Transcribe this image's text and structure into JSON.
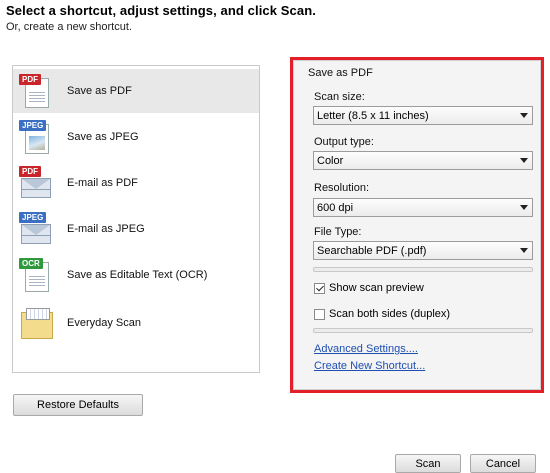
{
  "header": {
    "title": "Select a shortcut, adjust settings, and click Scan.",
    "subtitle": "Or, create a new shortcut."
  },
  "shortcuts": [
    {
      "label": "Save as PDF",
      "badge": "PDF",
      "icon": "pdf-document-icon",
      "selected": true
    },
    {
      "label": "Save as JPEG",
      "badge": "JPEG",
      "icon": "jpeg-document-icon",
      "selected": false
    },
    {
      "label": "E-mail as PDF",
      "badge": "PDF",
      "icon": "pdf-envelope-icon",
      "selected": false
    },
    {
      "label": "E-mail as JPEG",
      "badge": "JPEG",
      "icon": "jpeg-envelope-icon",
      "selected": false
    },
    {
      "label": "Save as Editable Text (OCR)",
      "badge": "OCR",
      "icon": "ocr-document-icon",
      "selected": false
    },
    {
      "label": "Everyday Scan",
      "badge": "",
      "icon": "folder-icon",
      "selected": false
    }
  ],
  "restore_label": "Restore Defaults",
  "settings": {
    "title": "Save as PDF",
    "scan_size": {
      "label": "Scan size:",
      "value": "Letter (8.5 x 11 inches)"
    },
    "output_type": {
      "label": "Output type:",
      "value": "Color"
    },
    "resolution": {
      "label": "Resolution:",
      "value": "600 dpi"
    },
    "file_type": {
      "label": "File Type:",
      "value": "Searchable PDF (.pdf)"
    },
    "show_preview": {
      "label": "Show scan preview",
      "checked": true
    },
    "duplex": {
      "label": "Scan both sides (duplex)",
      "checked": false
    },
    "advanced_link": "Advanced Settings....",
    "create_link": "Create New Shortcut..."
  },
  "footer": {
    "scan_label": "Scan",
    "cancel_label": "Cancel"
  },
  "colors": {
    "highlight_border": "#e3202a",
    "link": "#1f4fb0",
    "pdf_badge": "#c8262b",
    "jpeg_badge": "#3a6fc4",
    "ocr_badge": "#2f9a3d"
  }
}
